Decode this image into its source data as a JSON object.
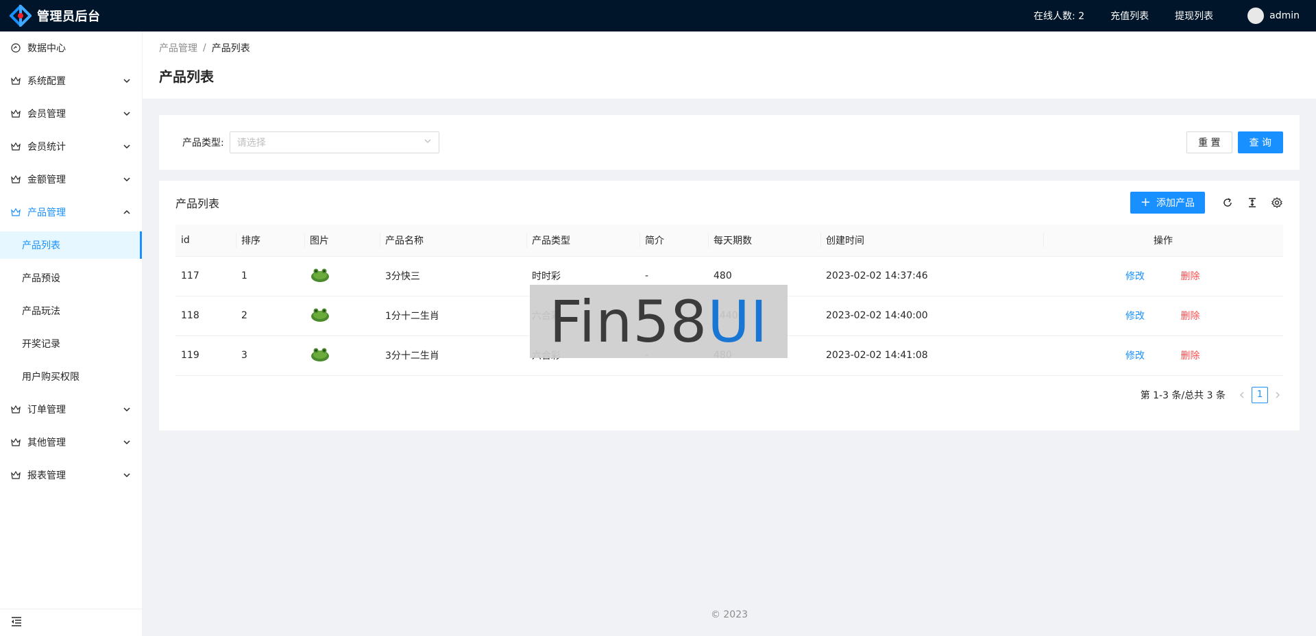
{
  "header": {
    "title": "管理员后台",
    "online": "在线人数: 2",
    "recharge": "充值列表",
    "withdraw": "提现列表",
    "username": "admin"
  },
  "sidebar": {
    "items": [
      {
        "label": "数据中心"
      },
      {
        "label": "系统配置"
      },
      {
        "label": "会员管理"
      },
      {
        "label": "会员统计"
      },
      {
        "label": "金额管理"
      },
      {
        "label": "产品管理"
      },
      {
        "label": "订单管理"
      },
      {
        "label": "其他管理"
      },
      {
        "label": "报表管理"
      }
    ],
    "sub_items": [
      {
        "label": "产品列表"
      },
      {
        "label": "产品预设"
      },
      {
        "label": "产品玩法"
      },
      {
        "label": "开奖记录"
      },
      {
        "label": "用户购买权限"
      }
    ]
  },
  "breadcrumb": {
    "parent": "产品管理",
    "separator": "/",
    "current": "产品列表"
  },
  "page_title": "产品列表",
  "filter": {
    "label": "产品类型:",
    "placeholder": "请选择",
    "reset": "重 置",
    "query": "查 询"
  },
  "table_card": {
    "title": "产品列表",
    "add_button": "添加产品",
    "columns": [
      "id",
      "排序",
      "图片",
      "产品名称",
      "产品类型",
      "简介",
      "每天期数",
      "创建时间",
      "操作"
    ],
    "rows": [
      {
        "id": "117",
        "sort": "1",
        "name": "3分快三",
        "type": "时时彩",
        "intro": "-",
        "per_day": "480",
        "created": "2023-02-02 14:37:46",
        "edit": "修改",
        "delete": "删除"
      },
      {
        "id": "118",
        "sort": "2",
        "name": "1分十二生肖",
        "type": "六合彩",
        "intro": "-",
        "per_day": "1440",
        "created": "2023-02-02 14:40:00",
        "edit": "修改",
        "delete": "删除"
      },
      {
        "id": "119",
        "sort": "3",
        "name": "3分十二生肖",
        "type": "六合彩",
        "intro": "-",
        "per_day": "480",
        "created": "2023-02-02 14:41:08",
        "edit": "修改",
        "delete": "删除"
      }
    ]
  },
  "pagination": {
    "total_text": "第 1-3 条/总共 3 条",
    "current_page": "1"
  },
  "watermark": {
    "part1": "Fin58",
    "part2": "UI"
  },
  "footer": "© 2023",
  "colors": {
    "primary": "#1890ff",
    "danger": "#ff4d4f",
    "header_bg": "#001529"
  }
}
